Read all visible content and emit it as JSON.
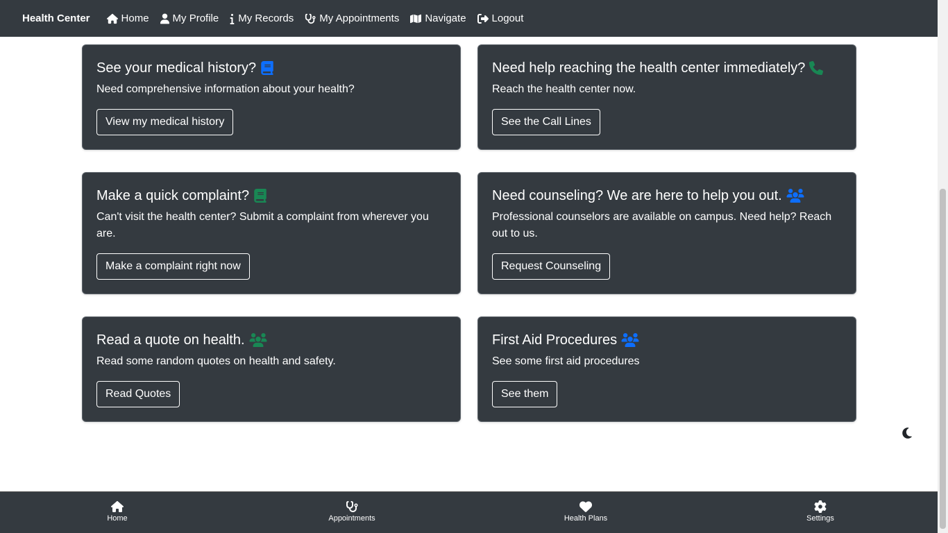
{
  "nav": {
    "brand": "Health Center",
    "items": [
      {
        "label": "Home",
        "icon": "home-icon"
      },
      {
        "label": "My Profile",
        "icon": "user-icon"
      },
      {
        "label": "My Records",
        "icon": "info-icon"
      },
      {
        "label": "My Appointments",
        "icon": "stethoscope-icon"
      },
      {
        "label": "Navigate",
        "icon": "map-icon"
      },
      {
        "label": "Logout",
        "icon": "logout-icon"
      }
    ]
  },
  "cards": [
    {
      "title": "See your medical history?",
      "icon": "book-icon",
      "icon_color": "#0d6efd",
      "text": "Need comprehensive information about your health?",
      "button": "View my medical history"
    },
    {
      "title": "Need help reaching the health center immediately?",
      "icon": "phone-icon",
      "icon_color": "#198754",
      "text": "Reach the health center now.",
      "button": "See the Call Lines"
    },
    {
      "title": "Make a quick complaint?",
      "icon": "book-icon",
      "icon_color": "#198754",
      "text": "Can't visit the health center? Submit a complaint from wherever you are.",
      "button": "Make a complaint right now"
    },
    {
      "title": "Need counseling? We are here to help you out.",
      "icon": "users-icon",
      "icon_color": "#0d6efd",
      "text": "Professional counselors are available on campus. Need help? Reach out to us.",
      "button": "Request Counseling"
    },
    {
      "title": "Read a quote on health.",
      "icon": "users-icon",
      "icon_color": "#198754",
      "text": "Read some random quotes on health and safety.",
      "button": "Read Quotes"
    },
    {
      "title": "First Aid Procedures",
      "icon": "users-icon",
      "icon_color": "#0d6efd",
      "text": "See some first aid procedures",
      "button": "See them"
    }
  ],
  "theme_toggle": {
    "icon": "moon-icon"
  },
  "bottom_nav": [
    {
      "label": "Home",
      "icon": "home-icon"
    },
    {
      "label": "Appointments",
      "icon": "stethoscope-icon"
    },
    {
      "label": "Health Plans",
      "icon": "heart-icon"
    },
    {
      "label": "Settings",
      "icon": "gear-icon"
    }
  ]
}
